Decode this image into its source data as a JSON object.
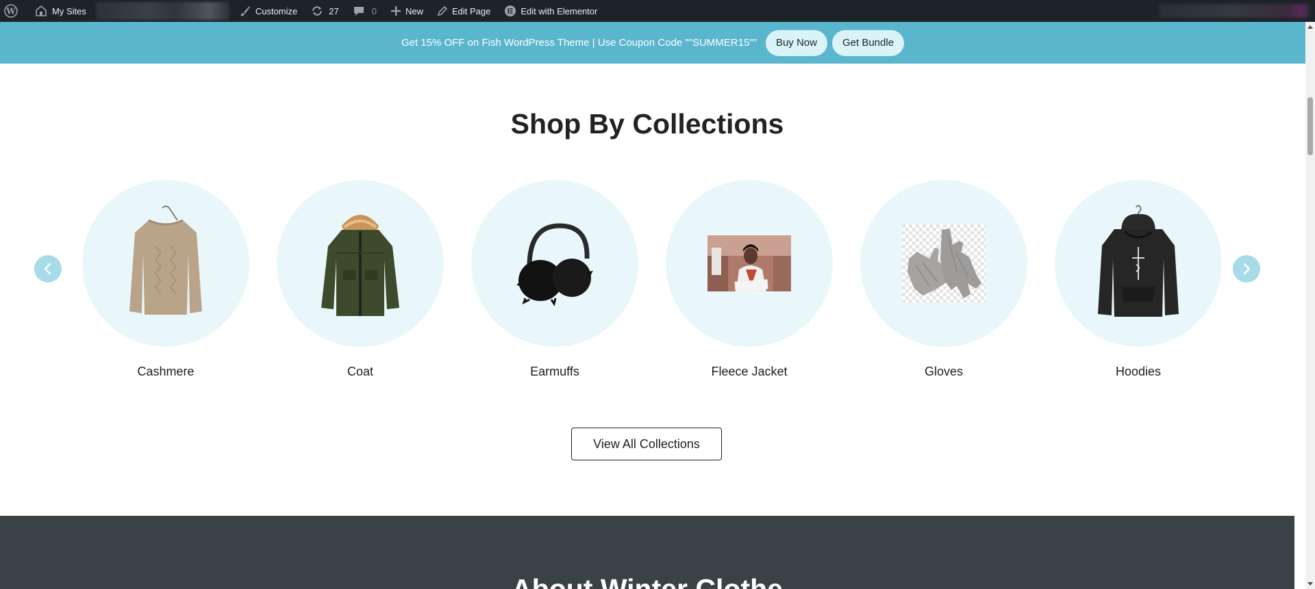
{
  "adminbar": {
    "my_sites": "My Sites",
    "customize": "Customize",
    "updates_count": "27",
    "comments_count": "0",
    "new": "New",
    "edit_page": "Edit Page",
    "edit_elementor": "Edit with Elementor"
  },
  "promo": {
    "text": "Get 15% OFF on Fish WordPress Theme | Use Coupon Code \"\"SUMMER15\"\"",
    "buy_now": "Buy Now",
    "get_bundle": "Get Bundle"
  },
  "collections": {
    "title": "Shop By Collections",
    "items": [
      {
        "label": "Cashmere",
        "icon": "sweater-image"
      },
      {
        "label": "Coat",
        "icon": "parka-coat-image"
      },
      {
        "label": "Earmuffs",
        "icon": "earmuffs-image"
      },
      {
        "label": "Fleece Jacket",
        "icon": "woman-reading-photo"
      },
      {
        "label": "Gloves",
        "icon": "knit-gloves-image"
      },
      {
        "label": "Hoodies",
        "icon": "hoodie-image"
      }
    ],
    "view_all": "View All Collections"
  },
  "about": {
    "title": "About Winter Clothe"
  },
  "colors": {
    "admin_bar": "#1d2327",
    "promo_bar": "#5ab6cd",
    "promo_button": "#d9f3f9",
    "circle_bg": "#e9f7fb",
    "arrow_bg": "#a8dbe8",
    "about_bg": "#3b4245"
  }
}
